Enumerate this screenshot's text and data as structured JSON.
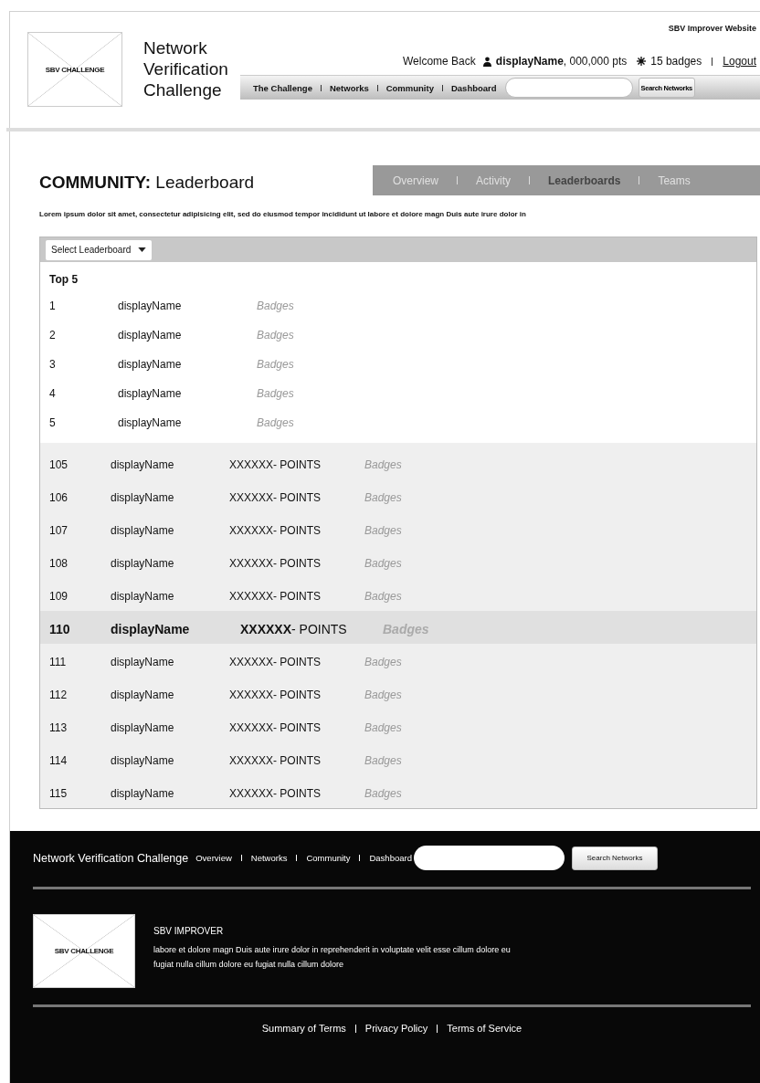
{
  "header": {
    "logo_text": "SBV CHALLENGE",
    "site_title": "Network Verification Challenge",
    "top_link": "SBV Improver Website",
    "welcome": "Welcome Back",
    "user": "**displayName**, 000,000 pts",
    "badges": "15 badges",
    "logout": "Logout",
    "nav": [
      "The Challenge",
      "Networks",
      "Community",
      "Dashboard"
    ],
    "search": {
      "button": "Search Networks"
    }
  },
  "page": {
    "title": "**COMMUNITY:** Leaderboard",
    "intro": "Lorem ipsum dolor sit amet, consectetur adipisicing elit, sed do eiusmod tempor incididunt ut labore et dolore magn Duis aute irure dolor in",
    "tabs": [
      {
        "label": "Overview",
        "selected": false
      },
      {
        "label": "Activity",
        "selected": false
      },
      {
        "label": "Leaderboards",
        "selected": true
      },
      {
        "label": "Teams",
        "selected": false
      }
    ]
  },
  "leaderboard": {
    "select": "Select Leaderboard",
    "top_heading": "Top 5",
    "rows": [
      {
        "kind": "top",
        "rank": "1",
        "name": "displayName",
        "badges": "Badges",
        "selected": false
      },
      {
        "kind": "top",
        "rank": "2",
        "name": "displayName",
        "badges": "Badges",
        "selected": false
      },
      {
        "kind": "top",
        "rank": "3",
        "name": "displayName",
        "badges": "Badges",
        "selected": false
      },
      {
        "kind": "top",
        "rank": "4",
        "name": "displayName",
        "badges": "Badges",
        "selected": false
      },
      {
        "kind": "top",
        "rank": "5",
        "name": "displayName",
        "badges": "Badges",
        "selected": false
      },
      {
        "kind": "ranked",
        "rank": "105",
        "name": "displayName",
        "points": "XXXXXX- POINTS",
        "badges": "Badges",
        "selected": false
      },
      {
        "kind": "ranked",
        "rank": "106",
        "name": "displayName",
        "points": "XXXXXX- POINTS",
        "badges": "Badges",
        "selected": false
      },
      {
        "kind": "ranked",
        "rank": "107",
        "name": "displayName",
        "points": "XXXXXX- POINTS",
        "badges": "Badges",
        "selected": false
      },
      {
        "kind": "ranked",
        "rank": "108",
        "name": "displayName",
        "points": "XXXXXX- POINTS",
        "badges": "Badges",
        "selected": false
      },
      {
        "kind": "ranked",
        "rank": "109",
        "name": "displayName",
        "points": "XXXXXX- POINTS",
        "badges": "Badges",
        "selected": false
      },
      {
        "kind": "ranked",
        "rank": "110",
        "name": "displayName",
        "points": "**XXXXXX**- POINTS",
        "badges": "Badges",
        "selected": true
      },
      {
        "kind": "ranked",
        "rank": "111",
        "name": "displayName",
        "points": "XXXXXX- POINTS",
        "badges": "Badges",
        "selected": false
      },
      {
        "kind": "ranked",
        "rank": "112",
        "name": "displayName",
        "points": "XXXXXX- POINTS",
        "badges": "Badges",
        "selected": false
      },
      {
        "kind": "ranked",
        "rank": "113",
        "name": "displayName",
        "points": "XXXXXX- POINTS",
        "badges": "Badges",
        "selected": false
      },
      {
        "kind": "ranked",
        "rank": "114",
        "name": "displayName",
        "points": "XXXXXX- POINTS",
        "badges": "Badges",
        "selected": false
      },
      {
        "kind": "ranked",
        "rank": "115",
        "name": "displayName",
        "points": "XXXXXX- POINTS",
        "badges": "Badges",
        "selected": false
      }
    ]
  },
  "footer": {
    "title": "Network Verification Challenge",
    "nav": [
      "Overview",
      "Networks",
      "Community",
      "Dashboard"
    ],
    "search": {
      "button": "Search Networks"
    },
    "logo_text": "SBV CHALLENGE",
    "org": "SBV IMPROVER",
    "about": "labore et dolore magn Duis aute irure dolor in reprehenderit in voluptate velit esse cillum dolore eu fugiat nulla cillum dolore eu fugiat nulla cillum dolore",
    "links": [
      "Summary of Terms",
      "Privacy Policy",
      "Terms of Service"
    ]
  }
}
